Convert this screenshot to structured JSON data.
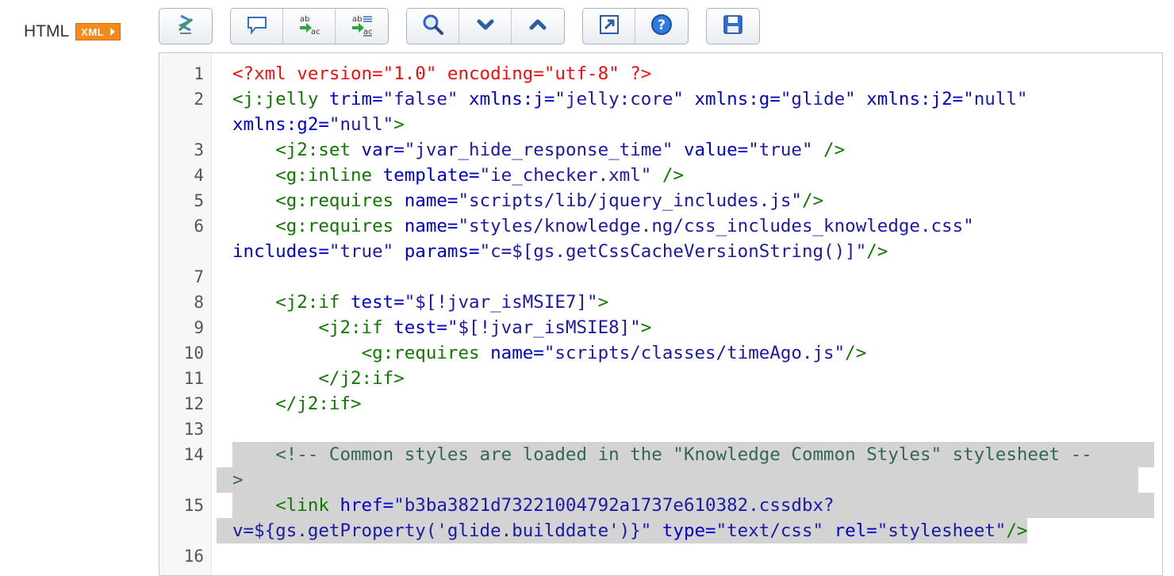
{
  "field": {
    "label": "HTML",
    "badge": "XML"
  },
  "toolbar": {
    "groups": [
      [
        {
          "name": "format-code-button",
          "icon": "format-icon",
          "title": "Format Code"
        }
      ],
      [
        {
          "name": "comment-button",
          "icon": "comment-icon",
          "title": "Comment"
        },
        {
          "name": "replace-button",
          "icon": "replace-icon",
          "title": "Replace"
        },
        {
          "name": "replace-all-button",
          "icon": "replace-all-icon",
          "title": "Replace All"
        }
      ],
      [
        {
          "name": "search-button",
          "icon": "search-icon",
          "title": "Search"
        },
        {
          "name": "find-next-button",
          "icon": "chevron-down-icon",
          "title": "Find Next"
        },
        {
          "name": "find-previous-button",
          "icon": "chevron-up-icon",
          "title": "Find Previous"
        }
      ],
      [
        {
          "name": "fullscreen-button",
          "icon": "expand-icon",
          "title": "Full Screen"
        },
        {
          "name": "help-button",
          "icon": "help-icon",
          "title": "Help"
        }
      ],
      [
        {
          "name": "save-button",
          "icon": "save-icon",
          "title": "Save"
        }
      ]
    ]
  },
  "colors": {
    "processing_instruction": "#ee1010",
    "tag": "#117700",
    "attribute": "#0000cc",
    "value": "#1a1aa6",
    "comment": "#336655",
    "selection": "#d3d3d3",
    "badge": "#f28a1c"
  },
  "editor": {
    "lines": [
      {
        "n": "1",
        "tokens": [
          [
            "pi",
            "<?xml version=\"1.0\" encoding=\"utf-8\" ?>"
          ]
        ]
      },
      {
        "n": "2",
        "tokens": [
          [
            "tag",
            "<j:jelly"
          ],
          [
            "attr",
            " trim="
          ],
          [
            "val",
            "\"false\""
          ],
          [
            "attr",
            " xmlns:j="
          ],
          [
            "val",
            "\"jelly:core\""
          ],
          [
            "attr",
            " xmlns:g="
          ],
          [
            "val",
            "\"glide\""
          ],
          [
            "attr",
            " xmlns:j2="
          ],
          [
            "val",
            "\"null\""
          ],
          [
            "br",
            ""
          ],
          [
            "attr",
            "xmlns:g2="
          ],
          [
            "val",
            "\"null\""
          ],
          [
            "tag",
            ">"
          ]
        ]
      },
      {
        "n": "3",
        "tokens": [
          [
            "plain",
            "    "
          ],
          [
            "tag",
            "<j2:set"
          ],
          [
            "attr",
            " var="
          ],
          [
            "val",
            "\"jvar_hide_response_time\""
          ],
          [
            "attr",
            " value="
          ],
          [
            "val",
            "\"true\""
          ],
          [
            "tag",
            " />"
          ]
        ]
      },
      {
        "n": "4",
        "tokens": [
          [
            "plain",
            "    "
          ],
          [
            "tag",
            "<g:inline"
          ],
          [
            "attr",
            " template="
          ],
          [
            "val",
            "\"ie_checker.xml\""
          ],
          [
            "tag",
            " />"
          ]
        ]
      },
      {
        "n": "5",
        "tokens": [
          [
            "plain",
            "    "
          ],
          [
            "tag",
            "<g:requires"
          ],
          [
            "attr",
            " name="
          ],
          [
            "val",
            "\"scripts/lib/jquery_includes.js\""
          ],
          [
            "tag",
            "/>"
          ]
        ]
      },
      {
        "n": "6",
        "tokens": [
          [
            "plain",
            "    "
          ],
          [
            "tag",
            "<g:requires"
          ],
          [
            "attr",
            " name="
          ],
          [
            "val",
            "\"styles/knowledge.ng/css_includes_knowledge.css\""
          ],
          [
            "br",
            ""
          ],
          [
            "attr",
            "includes="
          ],
          [
            "val",
            "\"true\""
          ],
          [
            "attr",
            " params="
          ],
          [
            "val",
            "\"c=$[gs.getCssCacheVersionString()]\""
          ],
          [
            "tag",
            "/>"
          ]
        ]
      },
      {
        "n": "7",
        "tokens": [
          [
            "plain",
            ""
          ]
        ]
      },
      {
        "n": "8",
        "tokens": [
          [
            "plain",
            "    "
          ],
          [
            "tag",
            "<j2:if"
          ],
          [
            "attr",
            " test="
          ],
          [
            "val",
            "\"$[!jvar_isMSIE7]\""
          ],
          [
            "tag",
            ">"
          ]
        ]
      },
      {
        "n": "9",
        "tokens": [
          [
            "plain",
            "        "
          ],
          [
            "tag",
            "<j2:if"
          ],
          [
            "attr",
            " test="
          ],
          [
            "val",
            "\"$[!jvar_isMSIE8]\""
          ],
          [
            "tag",
            ">"
          ]
        ]
      },
      {
        "n": "10",
        "tokens": [
          [
            "plain",
            "            "
          ],
          [
            "tag",
            "<g:requires"
          ],
          [
            "attr",
            " name="
          ],
          [
            "val",
            "\"scripts/classes/timeAgo.js\""
          ],
          [
            "tag",
            "/>"
          ]
        ]
      },
      {
        "n": "11",
        "tokens": [
          [
            "plain",
            "        "
          ],
          [
            "tag",
            "</j2:if>"
          ]
        ]
      },
      {
        "n": "12",
        "tokens": [
          [
            "plain",
            "    "
          ],
          [
            "tag",
            "</j2:if>"
          ]
        ]
      },
      {
        "n": "13",
        "tokens": [
          [
            "plain",
            ""
          ]
        ]
      },
      {
        "n": "14",
        "hl": true,
        "tokens": [
          [
            "plain",
            "    "
          ],
          [
            "cmt",
            "<!-- Common styles are loaded in the \"Knowledge Common Styles\" stylesheet --"
          ],
          [
            "br",
            ""
          ],
          [
            "cmt",
            ">"
          ]
        ]
      },
      {
        "n": "15",
        "hl": true,
        "tokens": [
          [
            "plain",
            "    "
          ],
          [
            "tag",
            "<link"
          ],
          [
            "attr",
            " href="
          ],
          [
            "val",
            "\"b3ba3821d73221004792a1737e610382.cssdbx?"
          ],
          [
            "br",
            ""
          ],
          [
            "val",
            "v=${gs.getProperty('glide.builddate')}\""
          ],
          [
            "attr",
            " type="
          ],
          [
            "val",
            "\"text/css\""
          ],
          [
            "attr",
            " rel="
          ],
          [
            "val",
            "\"stylesheet\""
          ],
          [
            "tag",
            "/>"
          ]
        ]
      },
      {
        "n": "16",
        "tokens": [
          [
            "plain",
            ""
          ]
        ]
      }
    ]
  }
}
